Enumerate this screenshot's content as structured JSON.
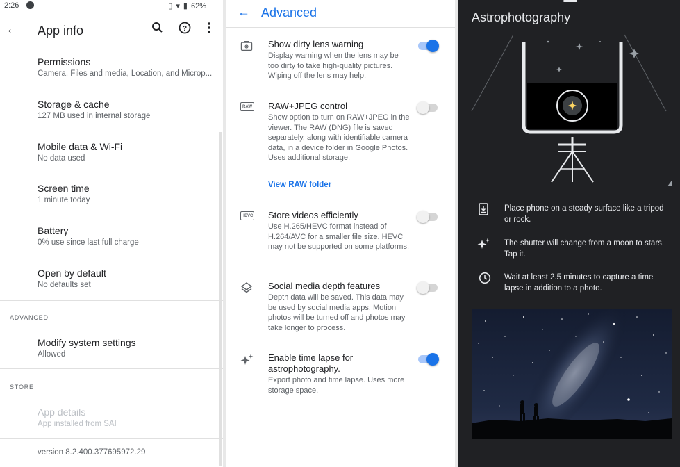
{
  "left": {
    "status": {
      "time": "2:26",
      "battery": "62%"
    },
    "appbar": {
      "back_icon": "arrow-back-icon",
      "title": "App info",
      "icons": [
        "search-icon",
        "help-icon",
        "more-vert-icon"
      ]
    },
    "items": [
      {
        "title": "Permissions",
        "subtitle": "Camera, Files and media, Location, and Microp..."
      },
      {
        "title": "Storage & cache",
        "subtitle": "127 MB used in internal storage"
      },
      {
        "title": "Mobile data & Wi-Fi",
        "subtitle": "No data used"
      },
      {
        "title": "Screen time",
        "subtitle": "1 minute today"
      },
      {
        "title": "Battery",
        "subtitle": "0% use since last full charge"
      },
      {
        "title": "Open by default",
        "subtitle": "No defaults set"
      }
    ],
    "advanced": {
      "header": "ADVANCED",
      "item": {
        "title": "Modify system settings",
        "subtitle": "Allowed"
      }
    },
    "store": {
      "header": "STORE",
      "item": {
        "title": "App details",
        "subtitle": "App installed from SAI"
      }
    },
    "version": "version 8.2.400.377695972.29"
  },
  "middle": {
    "title": "Advanced",
    "settings": [
      {
        "icon": "dirty-lens-icon",
        "title": "Show dirty lens warning",
        "desc": "Display warning when the lens may be too dirty to take high-quality pictures. Wiping off the lens may help.",
        "enabled": true
      },
      {
        "icon": "raw-icon",
        "icon_text": "RAW",
        "title": "RAW+JPEG control",
        "desc": "Show option to turn on RAW+JPEG in the viewer. The RAW (DNG) file is saved separately, along with identifiable camera data, in a device folder in Google Photos. Uses additional storage.",
        "link": "View RAW folder",
        "enabled": false
      },
      {
        "icon": "hevc-icon",
        "icon_text": "HEVC",
        "title": "Store videos efficiently",
        "desc": "Use H.265/HEVC format instead of H.264/AVC for a smaller file size. HEVC may not be supported on some platforms.",
        "enabled": false
      },
      {
        "icon": "layers-icon",
        "title": "Social media depth features",
        "desc": "Depth data will be saved. This data may be used by social media apps. Motion photos will be turned off and photos may take longer to process.",
        "enabled": false
      },
      {
        "icon": "sparkle-icon",
        "title": "Enable time lapse for astrophotography.",
        "desc": "Export photo and time lapse. Uses more storage space.",
        "enabled": true
      }
    ]
  },
  "right": {
    "title": "Astrophotography",
    "tips": [
      {
        "icon": "phone-download-icon",
        "text": "Place phone on a steady surface like a tripod or rock."
      },
      {
        "icon": "sparkle-icon",
        "text": "The shutter will change from a moon to stars. Tap it."
      },
      {
        "icon": "clock-icon",
        "text": "Wait at least 2.5 minutes to capture a time lapse in addition to a photo."
      }
    ]
  },
  "colors": {
    "accent": "#1a73e8",
    "dark_bg": "#202124"
  }
}
